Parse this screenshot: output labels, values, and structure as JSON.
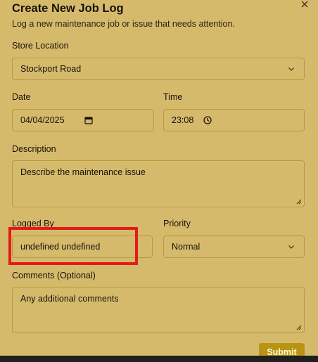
{
  "dialog": {
    "title": "Create New Job Log",
    "subtitle": "Log a new maintenance job or issue that needs attention.",
    "close_icon": "close-icon"
  },
  "store_location": {
    "label": "Store Location",
    "value": "Stockport Road"
  },
  "date": {
    "label": "Date",
    "value": "04/04/2025"
  },
  "time": {
    "label": "Time",
    "value": "23:08"
  },
  "description": {
    "label": "Description",
    "placeholder": "Describe the maintenance issue"
  },
  "logged_by": {
    "label": "Logged By",
    "value": "undefined undefined"
  },
  "priority": {
    "label": "Priority",
    "value": "Normal"
  },
  "comments": {
    "label": "Comments (Optional)",
    "placeholder": "Any additional comments"
  },
  "submit_label": "Submit",
  "colors": {
    "background": "#d6ba6c",
    "border": "#b89a3e",
    "highlight": "#e31b1b",
    "button": "#b89412"
  }
}
